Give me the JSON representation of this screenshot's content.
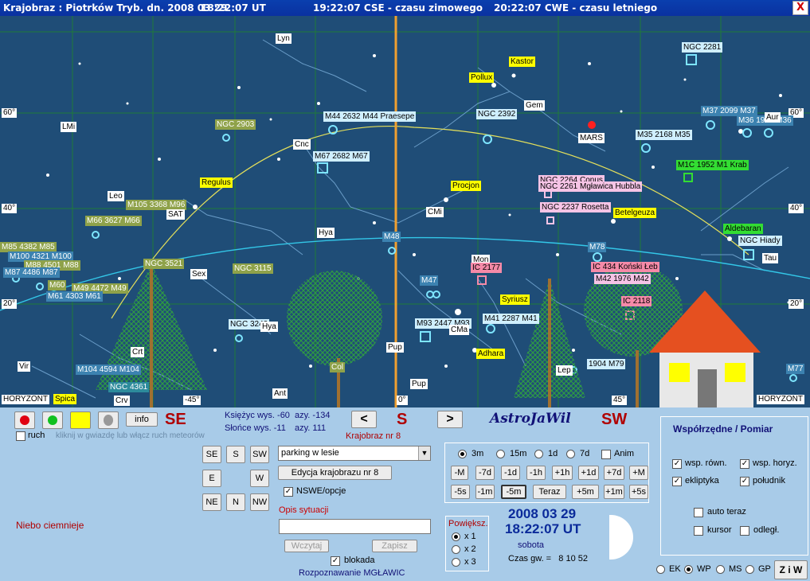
{
  "titlebar": {
    "part1": "Krajobraz : Piotrków Tryb. dn. 2008 03 29",
    "part2": "18:22:07 UT",
    "part3": "19:22:07 CSE - czasu zimowego",
    "part4": "20:22:07 CWE - czasu letniego",
    "close": "X"
  },
  "sky": {
    "degrees": {
      "l60": "60°",
      "l40": "40°",
      "l20": "20°",
      "r60": "60°",
      "r40": "40°",
      "r20": "20°",
      "b45l": "-45°",
      "b0": "0°",
      "b45r": "45°"
    },
    "horizon_left": "HORYZONT",
    "horizon_right": "HORYZONT",
    "labels": {
      "lyn": "Lyn",
      "kastor": "Kastor",
      "pollux": "Pollux",
      "gem": "Gem",
      "ngc2281": "NGC 2281",
      "m37": "M37 2099 M37",
      "m36": "M36 1960 M36",
      "aur": "Aur",
      "lmi": "LMi",
      "ngc2903": "NGC 2903",
      "m44": "M44 2632 M44 Praesepe",
      "ngc2392": "NGC 2392",
      "cnc": "Cnc",
      "mars": "MARS",
      "m35": "M35 2168 M35",
      "m67": "M67 2682 M67",
      "m1": "M1C 1952 M1 Krab",
      "regulus": "Regulus",
      "ngc2264": "NGC 2264 Conus",
      "ngc2261": "NGC 2261 Mgławica Hubbla",
      "procjon": "Procjon",
      "leo": "Leo",
      "m105": "M105 3368 M96",
      "sat": "SAT",
      "cmi": "CMi",
      "ngc2237": "NGC 2237 Rosetta",
      "betelgeuza": "Betelgeuza",
      "m66": "M66 3627 M66",
      "aldebaran": "Aldebaran",
      "ngchiady": "NGC Hiady",
      "hya": "Hya",
      "m48": "M48",
      "m78": "M78",
      "m85": "M85 4382 M85",
      "m100": "M100 4321 M100",
      "m88": "M88 4501 M88",
      "m87": "M87 4486 M87",
      "ngc3521": "NGC 3521",
      "sex": "Sex",
      "ngc3115": "NGC 3115",
      "mon": "Mon",
      "ic2177": "IC 2177",
      "ic434": "IC 434 Koński Łeb",
      "m42": "M42 1976 M42",
      "tau": "Tau",
      "m60": "M60",
      "m49": "M49 4472 M49",
      "m61": "M61 4303 M61",
      "m47": "M47",
      "syriusz": "Syriusz",
      "ic2118": "IC 2118",
      "ngc3242": "NGC 3242",
      "hya2": "Hya",
      "m93": "M93 2447 M93",
      "cma": "CMa",
      "m41": "M41 2287 M41",
      "crt": "Crt",
      "pup": "Pup",
      "adhara": "Adhara",
      "vir": "Vir",
      "m104": "M104 4594 M104",
      "crv": "Crv",
      "pup2": "Pup",
      "lep": "Lep",
      "m79": "1904 M79",
      "m77": "M77",
      "ngc4361": "NGC 4361",
      "spica": "Spica",
      "ant": "Ant",
      "col": "Col"
    }
  },
  "panel": {
    "se": "SE",
    "s": "S",
    "sw": "SW",
    "astro": "AstroJaWil",
    "info_btn": "info",
    "ruch": "ruch",
    "ruch_hint": "kliknij w gwiazdę lub włącz ruch meteorów",
    "moon": {
      "label": "Księżyc wys.",
      "alt": "-60",
      "az_label": "azy.",
      "az": "-134"
    },
    "sun": {
      "label": "Słońce wys.",
      "alt": "-11",
      "az_label": "azy.",
      "az": "111"
    },
    "prev": "<",
    "next": ">",
    "krajobraz_nr": "Krajobraz nr 8",
    "dir_buttons": [
      "SE",
      "S",
      "SW",
      "E",
      "W",
      "NE",
      "N",
      "NW"
    ],
    "landscape_select": "parking w lesie",
    "edit_btn": "Edycja krajobrazu nr 8",
    "nswe": "NSWE/opcje",
    "opis": "Opis sytuacji",
    "opis_value": "",
    "wczytaj": "Wczytaj",
    "zapisz": "Zapisz",
    "blokada": "blokada",
    "rozpoznawanie": "Rozpoznawanie MGŁAWIC",
    "niebo": "Niebo ciemnieje",
    "time_radios": [
      "3m",
      "15m",
      "1d",
      "7d"
    ],
    "anim": "Anim",
    "step_row1": [
      "-M",
      "-7d",
      "-1d",
      "-1h",
      "+1h",
      "+1d",
      "+7d",
      "+M"
    ],
    "step_row2": [
      "-5s",
      "-1m",
      "-5m",
      "Teraz",
      "+5m",
      "+1m",
      "+5s"
    ],
    "powieksz": "Powiększ.",
    "zoom": [
      "x 1",
      "x 2",
      "x 3"
    ],
    "date": "2008 03 29",
    "time": "18:22:07 UT",
    "day": "sobota",
    "czas_gw_label": "Czas gw. =",
    "czas_gw": "8 10 52",
    "coords_title": "Współrzędne / Pomiar",
    "coords": {
      "wsp_rown": "wsp. równ.",
      "wsp_horyz": "wsp. horyz.",
      "ekliptyka": "ekliptyka",
      "poludnik": "południk",
      "auto_teraz": "auto teraz",
      "kursor": "kursor",
      "odleg": "odległ."
    },
    "bottom_radios": [
      "EK",
      "WP",
      "MS",
      "GP"
    ],
    "ziw": "Z i W",
    "colors": {
      "accent_red": "#b00000",
      "dark_blue": "#111177",
      "sky": "#1f4d77"
    }
  }
}
